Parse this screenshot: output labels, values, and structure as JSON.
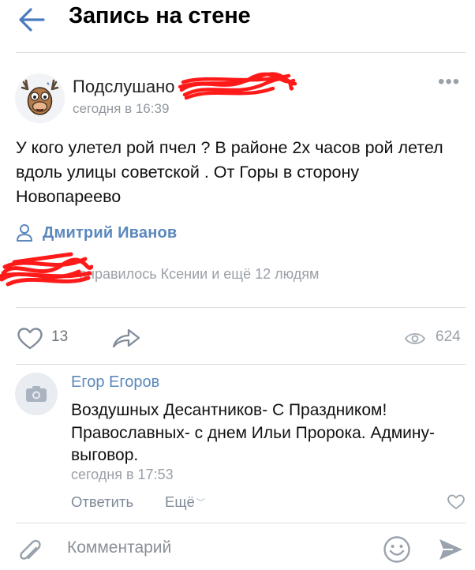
{
  "header": {
    "title": "Запись на стене"
  },
  "post": {
    "author": "Подслушано",
    "time": "сегодня в 16:39",
    "text": "У кого улетел рой пчел ? В районе 2х часов рой летел вдоль улицы советской . От Горы в сторону Новопареево",
    "signer": "Дмитрий Иванов",
    "likes_text": "онравилось Ксении и ещё 12 людям",
    "likes_count": "13",
    "views_count": "624"
  },
  "comment": {
    "author": "Егор Егоров",
    "text": "Воздушных Десантников- С Праздником! Православных- с днем Ильи Пророка. Админу-выговор.",
    "time": "сегодня в 17:53",
    "reply_label": "Ответить",
    "more_label": "Ещё"
  },
  "composer": {
    "placeholder": "Комментарий"
  },
  "colors": {
    "accent": "#5b88bd",
    "header_arrow": "#4a7bbf",
    "secondary_text": "#9aa0a8",
    "divider": "#dcdde0",
    "redaction": "#ff1a1a"
  },
  "icons": [
    "back-arrow-icon",
    "more-dots-icon",
    "user-icon",
    "heart-icon",
    "share-icon",
    "eye-icon",
    "camera-icon",
    "chevron-down-icon",
    "attach-icon",
    "emoji-icon",
    "send-icon"
  ]
}
